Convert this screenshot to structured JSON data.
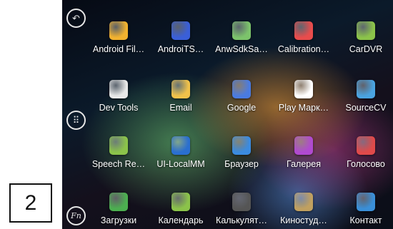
{
  "page_marker": "2",
  "sidebar": {
    "back_label": "↶",
    "menu_label": "⠿",
    "fn_label": "Fn"
  },
  "apps": [
    {
      "label": "Android Fil…",
      "icon": "folder-icon",
      "color": "#f2b22f"
    },
    {
      "label": "AndroiTS…",
      "icon": "globe-target-icon",
      "color": "#3a5fd8"
    },
    {
      "label": "AnwSdkSa…",
      "icon": "android-doc-icon",
      "color": "#7cc36b"
    },
    {
      "label": "Calibration…",
      "icon": "calibration-x-icon",
      "color": "#e84c4c"
    },
    {
      "label": "CarDVR",
      "icon": "android-robot-icon",
      "color": "#8bc34a"
    },
    {
      "label": "Dev Tools",
      "icon": "gear-icon",
      "color": "#e8e8e8"
    },
    {
      "label": "Email",
      "icon": "envelope-icon",
      "color": "#f0c14a"
    },
    {
      "label": "Google",
      "icon": "google-search-icon",
      "color": "#4a7be0"
    },
    {
      "label": "Play Марк…",
      "icon": "play-store-icon",
      "color": "#ffffff"
    },
    {
      "label": "SourceCV",
      "icon": "chat-bubble-icon",
      "color": "#4aa3e0"
    },
    {
      "label": "Speech Re…",
      "icon": "android-robot-icon",
      "color": "#8bc34a"
    },
    {
      "label": "UI-LocalMM",
      "icon": "media-player-icon",
      "color": "#2a6fd0"
    },
    {
      "label": "Браузер",
      "icon": "globe-icon",
      "color": "#3b8be0"
    },
    {
      "label": "Галерея",
      "icon": "gallery-icon",
      "color": "#b04ad0"
    },
    {
      "label": "Голосово",
      "icon": "microphone-icon",
      "color": "#e04a4a"
    },
    {
      "label": "Загрузки",
      "icon": "download-icon",
      "color": "#4caf50"
    },
    {
      "label": "Календарь",
      "icon": "calendar-icon",
      "color": "#8bc34a"
    },
    {
      "label": "Калькулят…",
      "icon": "calculator-icon",
      "color": "#555555"
    },
    {
      "label": "Киностуд…",
      "icon": "clapperboard-icon",
      "color": "#c0a060"
    },
    {
      "label": "Контакт",
      "icon": "contacts-icon",
      "color": "#3a8fd8"
    }
  ]
}
